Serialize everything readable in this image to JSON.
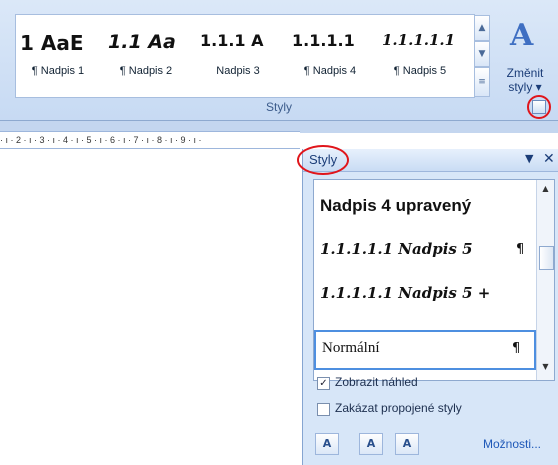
{
  "ribbon": {
    "gallery": [
      {
        "preview": "1 AaE",
        "name": "¶ Nadpis 1"
      },
      {
        "preview": "1.1 Aa",
        "name": "¶ Nadpis 2"
      },
      {
        "preview": "1.1.1 A",
        "name": "Nadpis 3"
      },
      {
        "preview": "1.1.1.1",
        "name": "¶ Nadpis 4"
      },
      {
        "preview": "1.1.1.1.1",
        "name": "¶ Nadpis 5"
      }
    ],
    "change_styles": {
      "line1": "Změnit",
      "line2": "styly ▾"
    },
    "group_label": "Styly"
  },
  "ruler": {
    "text": "· ı · 2 · ı · 3 · ı · 4 · ı · 5 · ı · 6 · ı · 7 · ı · 8 · ı · 9 · ı ·"
  },
  "pane": {
    "title": "Styly",
    "items": [
      {
        "label": "Nadpis 4 upravený",
        "para": ""
      },
      {
        "label": "1.1.1.1.1  Nadpis 5",
        "para": "¶"
      },
      {
        "label": "1.1.1.1.1  Nadpis 5 +",
        "para": ""
      },
      {
        "label": "Normální",
        "para": "¶"
      }
    ],
    "show_preview": {
      "label": "Zobrazit náhled",
      "checked": true
    },
    "disable_linked": {
      "label": "Zakázat propojené styly",
      "checked": false
    },
    "options_link": "Možnosti..."
  },
  "colors": {
    "highlight_ring": "#e0151b",
    "ribbon_bg": "#c7daf3",
    "pane_bg": "#d7e6f8"
  }
}
